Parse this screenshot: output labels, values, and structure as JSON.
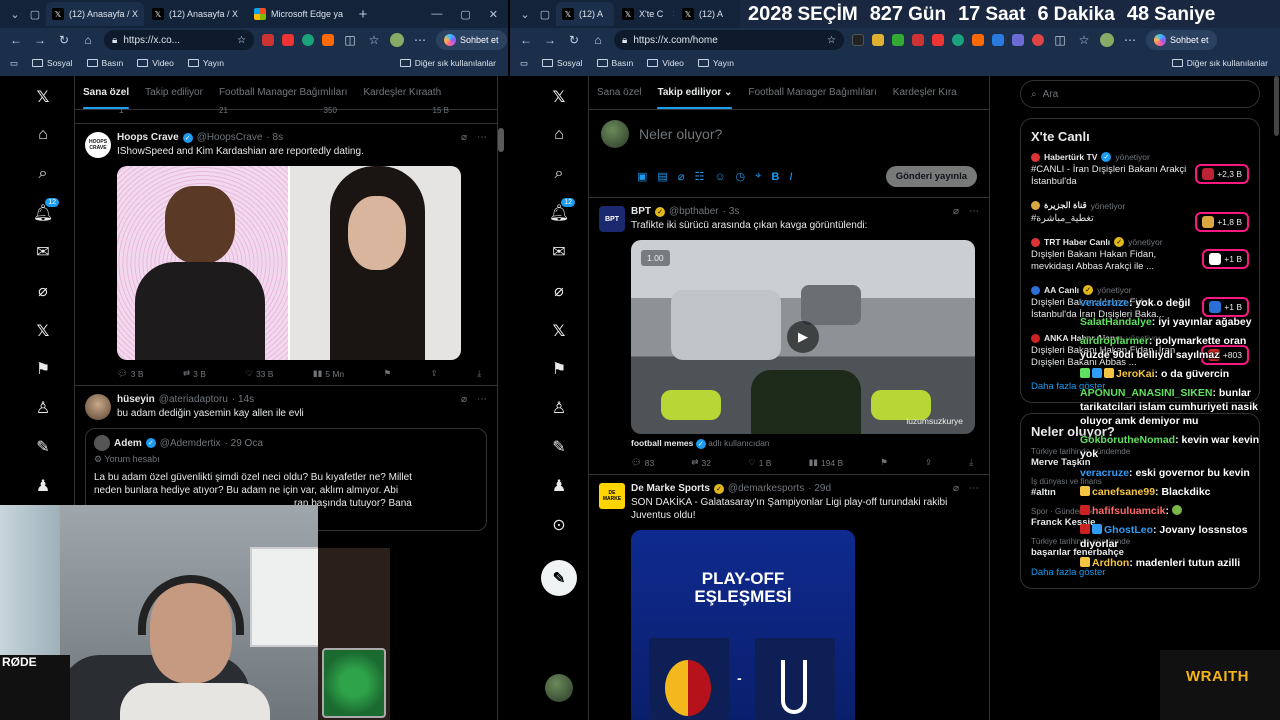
{
  "left": {
    "tabs": [
      {
        "label": "(12) Anasayfa / X",
        "active": true
      },
      {
        "label": "(12) Anasayfa / X",
        "active": false
      },
      {
        "label": "Microsoft Edge ya",
        "active": false
      }
    ],
    "url": "https://x.co...",
    "sohbet": "Sohbet et",
    "favorites": [
      "Sosyal",
      "Basın",
      "Video",
      "Yayın"
    ],
    "other_favorites": "Diğer sık kullanılanlar",
    "badge_count": "12",
    "feed_tabs": [
      "Sana özel",
      "Takip ediliyor",
      "Football Manager Bağımlıları",
      "Kardeşler Kıraath"
    ],
    "top_stats": [
      "1",
      "21",
      "350",
      "15 B"
    ],
    "posts": [
      {
        "name": "Hoops Crave",
        "handle": "@HoopsCrave",
        "time": "· 8s",
        "text": "IShowSpeed and Kim Kardashian are reportedly dating.",
        "avatar_text": "HOOPS CRAVE",
        "stats": {
          "replies": "3 B",
          "reposts": "3 B",
          "likes": "33 B",
          "views": "5 Mn"
        }
      },
      {
        "name": "hüseyin",
        "handle": "@ateriadaptoru",
        "time": "· 14s",
        "text": "bu adam dediğin yasemin kay allen ile evli",
        "quote": {
          "name": "Adem",
          "handle": "@Ademdertix",
          "time": "· 29 Oca",
          "label": "Yorum hesabı",
          "text_lines": [
            "La bu adam özel güvenlikti şimdi özel neci oldu? Bu kıyafetler ne? Millet",
            "neden bunlara hediye atıyor? Bu adam ne için var, aklım almıyor. Abi",
            "ran başında tutuyor? Bana"
          ]
        }
      }
    ]
  },
  "right": {
    "tabs": [
      "(12) A",
      "X'te C",
      "(12) A"
    ],
    "url": "https://x.com/home",
    "sohbet": "Sohbet et",
    "favorites": [
      "Sosyal",
      "Basın",
      "Video",
      "Yayın"
    ],
    "other_favorites": "Diğer sık kullanılanlar",
    "badge_count": "12",
    "feed_tabs": [
      "Sana özel",
      "Takip ediliyor",
      "Football Manager Bağımlıları",
      "Kardeşler Kıra"
    ],
    "compose_placeholder": "Neler oluyor?",
    "publish": "Gönderi yayınla",
    "posts": [
      {
        "name": "BPT",
        "handle": "@bpthaber",
        "time": "· 3s",
        "text": "Trafikte iki sürücü arasında çıkan kavga görüntülendi:",
        "avatar_text": "BPT",
        "video_speed": "1.00",
        "watermark": "luzumsuzkurye",
        "source": "football memes",
        "source_suffix": "adlı kullanıcıdan",
        "stats": {
          "replies": "83",
          "reposts": "32",
          "likes": "1 B",
          "views": "194 B"
        }
      },
      {
        "name": "De Marke Sports",
        "handle": "@demarkesports",
        "time": "· 29d",
        "text_lines": [
          "SON DAKİKA - Galatasaray'ın Şampiyonlar Ligi play-off turundaki rakibi",
          "Juventus oldu!"
        ],
        "avatar_text": "DE MARKE",
        "card_title": [
          "PLAY-OFF",
          "EŞLEŞMESİ"
        ]
      }
    ],
    "search_placeholder": "Ara",
    "live_title": "X'te Canlı",
    "live": [
      {
        "source": "Habertürk TV",
        "role": "yönetiyor",
        "title": "#CANLI - İran Dışişleri Bakanı Arakçi İstanbul'da",
        "count": "+2,3 B"
      },
      {
        "source": "قناة الجزيرة",
        "role": "yönetiyor",
        "title": "#تغطية_مباشرة",
        "count": "+1,8 B"
      },
      {
        "source": "TRT Haber Canlı",
        "role": "yönetiyor",
        "title": "Dışişleri Bakanı Hakan Fidan, mevkidaşı Abbas Arakçi ile ...",
        "count": "+1 B"
      },
      {
        "source": "AA Canlı",
        "role": "yönetiyor",
        "title": "Dışişleri Bakanı Hakan Fidan, İstanbul'da İran Dışişleri Baka...",
        "count": "+1 B"
      },
      {
        "source": "ANKA Haber Ajansı",
        "role": "yönetiyor",
        "title": "Dışişleri Bakanı Hakan Fidan, İran Dışişleri Bakanı Abbas ...",
        "count": "+803"
      }
    ],
    "more": "Daha fazla göster",
    "trends_title": "Neler oluyor?",
    "trends": [
      {
        "cat": "Türkiye tarihinde gündemde",
        "name": "Merve Taşkın"
      },
      {
        "cat": "İş dünyası ve finans",
        "name": "#altın"
      },
      {
        "cat": "Spor · Gündemde",
        "name": "Franck Kessie"
      },
      {
        "cat": "Türkiye tarihinde gündemde",
        "name": "başarılar fenerbahçe"
      }
    ],
    "trends_more": "Daha fazla göster"
  },
  "countdown": {
    "year": "2028",
    "label": "SEÇİM",
    "days": "827",
    "days_label": "Gün",
    "hours": "17",
    "hours_label": "Saat",
    "minutes": "6",
    "minutes_label": "Dakika",
    "seconds": "48",
    "seconds_label": "Saniye"
  },
  "chat": [
    {
      "user": "veracruze",
      "msg": "yok o değil",
      "color": "b"
    },
    {
      "user": "SalatHandalye",
      "msg": "iyi yayınlar ağabey",
      "color": "g"
    },
    {
      "user": "airdropfarmer",
      "msg": "polymarkette oran yüzde 90dı belliydi sayılmaz",
      "color": "g"
    },
    {
      "user": "JeroKai",
      "msg": "o da güvercin",
      "color": "y"
    },
    {
      "user": "APONUN_ANASINI_SIKEN",
      "msg": "bunlar tarikatcilari islam cumhuriyeti nasik oluyor amk demiyor mu",
      "color": "g"
    },
    {
      "user": "GokborutheNomad",
      "msg": "kevin war kevin yok",
      "color": "g"
    },
    {
      "user": "veracruze",
      "msg": "eski governor bu kevin",
      "color": "b"
    },
    {
      "user": "canefsane99",
      "msg": "Blackdikc",
      "color": "y"
    },
    {
      "user": "hafifsuluamcik",
      "msg": "",
      "color": "r"
    },
    {
      "user": "GhostLeo",
      "msg": "Jovany lossnstos diyorlar",
      "color": "b"
    },
    {
      "user": "Ardhon",
      "msg": "madenleri tutun azilli",
      "color": "y"
    }
  ],
  "overlay": {
    "cam_shirt_text": "RØDE",
    "brand": "WRAITH"
  },
  "colors": {
    "accent": "#1d9bf0",
    "live_border": "#f91880",
    "chrome": "#1c2f4a"
  }
}
